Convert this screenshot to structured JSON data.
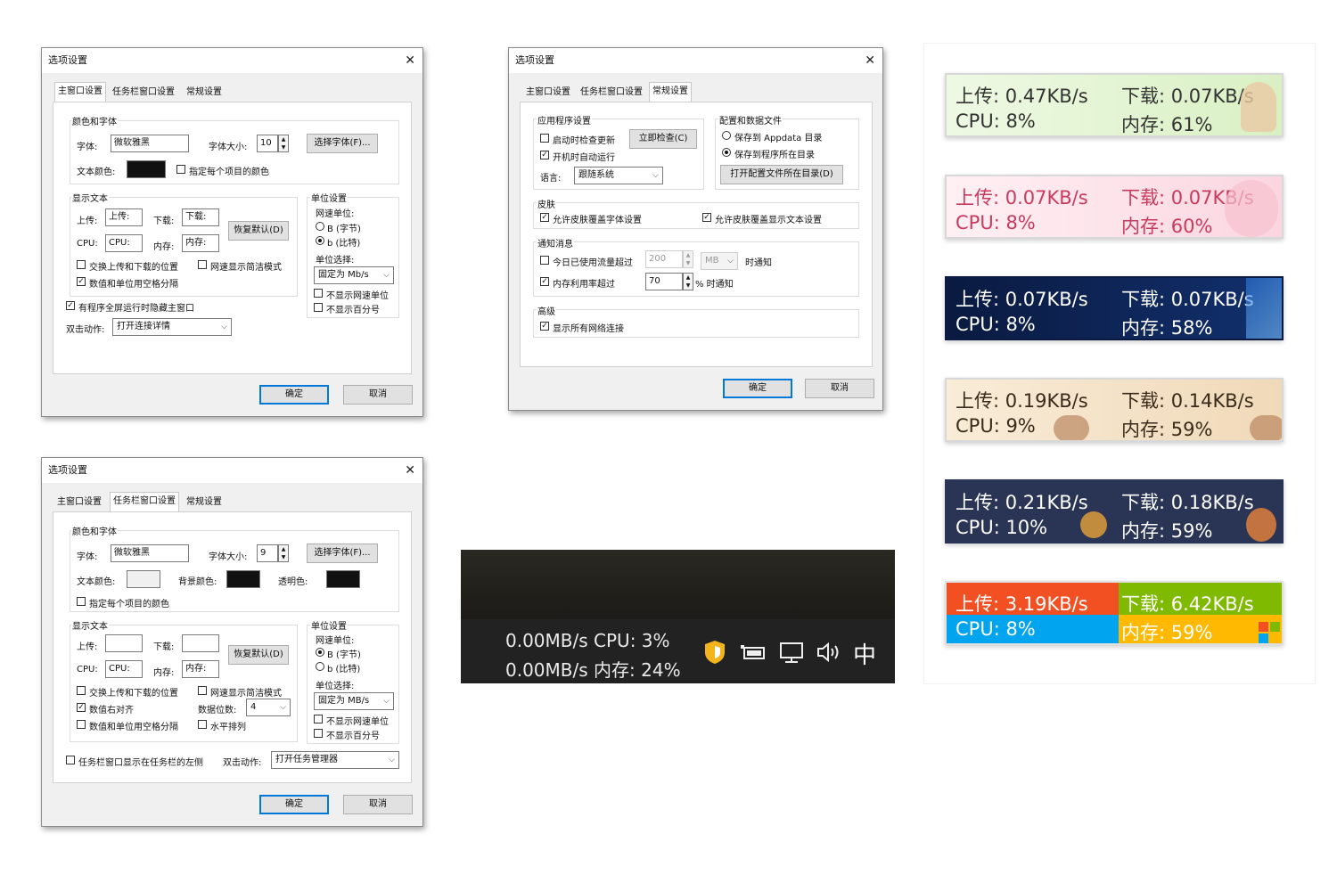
{
  "dialog_title": "选项设置",
  "tabs": {
    "main": "主窗口设置",
    "taskbar": "任务栏窗口设置",
    "general": "常规设置"
  },
  "common": {
    "ok": "确定",
    "cancel": "取消",
    "color_font_group": "颜色和字体",
    "font_label": "字体:",
    "font_value": "微软雅黑",
    "font_size_label": "字体大小:",
    "choose_font": "选择字体(F)...",
    "text_color_label": "文本颜色:",
    "display_text_group": "显示文本",
    "upload_label": "上传:",
    "download_label": "下载:",
    "cpu_label": "CPU:",
    "mem_label": "内存:",
    "cpu_value": "CPU:",
    "mem_value": "内存:",
    "restore_default": "恢复默认(D)",
    "swap_pos": "交换上传和下载的位置",
    "speed_simple": "网速显示简洁模式",
    "space_sep": "数值和单位用空格分隔",
    "unit_group": "单位设置",
    "speed_unit": "网速单位:",
    "unit_B": "B (字节)",
    "unit_b": "b (比特)",
    "unit_choose": "单位选择:",
    "hide_unit": "不显示网速单位",
    "hide_percent": "不显示百分号",
    "dblclick": "双击动作:"
  },
  "main_tab": {
    "font_size": "10",
    "per_item_color": "指定每个项目的颜色",
    "text_color": "#111111",
    "upload_value": "上传:",
    "download_value": "下载:",
    "unit_select": "固定为 Mb/s",
    "hide_fullscreen": "有程序全屏运行时隐藏主窗口",
    "dblclick_action": "打开连接详情"
  },
  "taskbar_tab": {
    "font_size": "9",
    "bg_color_label": "背景颜色:",
    "opacity_label": "透明色:",
    "text_color": "#f0f0f0",
    "bg_color": "#111111",
    "opacity_color": "#111111",
    "per_item_color": "指定每个项目的颜色",
    "upload_value": "",
    "download_value": "",
    "right_align": "数值右对齐",
    "digits_label": "数据位数:",
    "digits_value": "4",
    "horizontal": "水平排列",
    "unit_select": "固定为 MB/s",
    "show_left": "任务栏窗口显示在任务栏的左侧",
    "dblclick_action": "打开任务管理器"
  },
  "general_tab": {
    "app_group": "应用程序设置",
    "check_update": "启动时检查更新",
    "check_now": "立即检查(C)",
    "autostart": "开机时自动运行",
    "lang_label": "语言:",
    "lang_value": "跟随系统",
    "config_group": "配置和数据文件",
    "save_appdata": "保存到 Appdata 目录",
    "save_prog": "保存到程序所在目录",
    "open_config": "打开配置文件所在目录(D)",
    "skin_group": "皮肤",
    "skin_font": "允许皮肤覆盖字体设置",
    "skin_text": "允许皮肤覆盖显示文本设置",
    "notify_group": "通知消息",
    "traffic_over": "今日已使用流量超过",
    "traffic_value": "200",
    "traffic_unit": "MB",
    "notify_suffix": "时通知",
    "mem_over": "内存利用率超过",
    "mem_value": "70",
    "mem_suffix": "% 时通知",
    "adv_group": "高级",
    "show_all": "显示所有网络连接"
  },
  "taskbar_preview": {
    "line1": "0.00MB/s CPU:   3%",
    "line2": "0.00MB/s 内存: 24%",
    "ime": "中"
  },
  "skins": [
    {
      "up": "上传: 0.47KB/s",
      "down": "下载: 0.07KB/s",
      "cpu": "CPU: 8%",
      "mem": "内存: 61%",
      "bg": "#e4f5d6",
      "fg": "#333333"
    },
    {
      "up": "上传: 0.07KB/s",
      "down": "下载: 0.07KB/s",
      "cpu": "CPU: 8%",
      "mem": "内存: 60%",
      "bg": "#fde3ea",
      "fg": "#c83a5e"
    },
    {
      "up": "上传: 0.07KB/s",
      "down": "下载: 0.07KB/s",
      "cpu": "CPU: 8%",
      "mem": "内存: 58%",
      "bg": "#0b1f4a",
      "fg": "#ffffff"
    },
    {
      "up": "上传: 0.19KB/s",
      "down": "下载: 0.14KB/s",
      "cpu": "CPU: 9%",
      "mem": "内存: 59%",
      "bg": "#f6e6cf",
      "fg": "#3a2a1a"
    },
    {
      "up": "上传: 0.21KB/s",
      "down": "下载: 0.18KB/s",
      "cpu": "CPU: 10%",
      "mem": "内存: 59%",
      "bg": "#2a3556",
      "fg": "#ffffff"
    },
    {
      "up": "上传: 3.19KB/s",
      "down": "下载: 6.42KB/s",
      "cpu": "CPU: 8%",
      "mem": "内存: 59%",
      "bg": "multicolor",
      "fg": "#ffffff"
    }
  ]
}
